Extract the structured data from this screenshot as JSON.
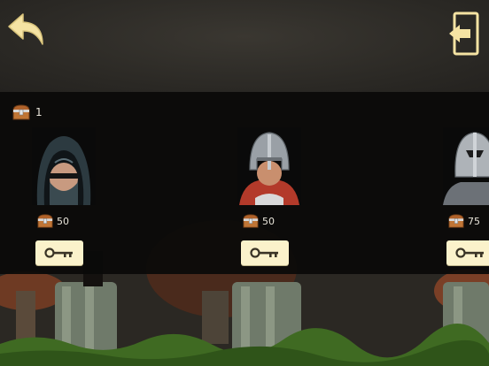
{
  "owned_count": "1",
  "characters": [
    {
      "name_icon": "hooded-assassin-portrait",
      "price": "50"
    },
    {
      "name_icon": "red-helmet-knight-portrait",
      "price": "50"
    },
    {
      "name_icon": "armored-knight-portrait",
      "price": "75"
    }
  ],
  "icons": {
    "back": "back-arrow-icon",
    "exit": "exit-door-icon",
    "currency": "treasure-chest-icon",
    "unlock": "key-icon"
  },
  "colors": {
    "accent": "#f5e3a3",
    "button_bg": "#fbf2cb",
    "panel": "#0a0a09"
  }
}
